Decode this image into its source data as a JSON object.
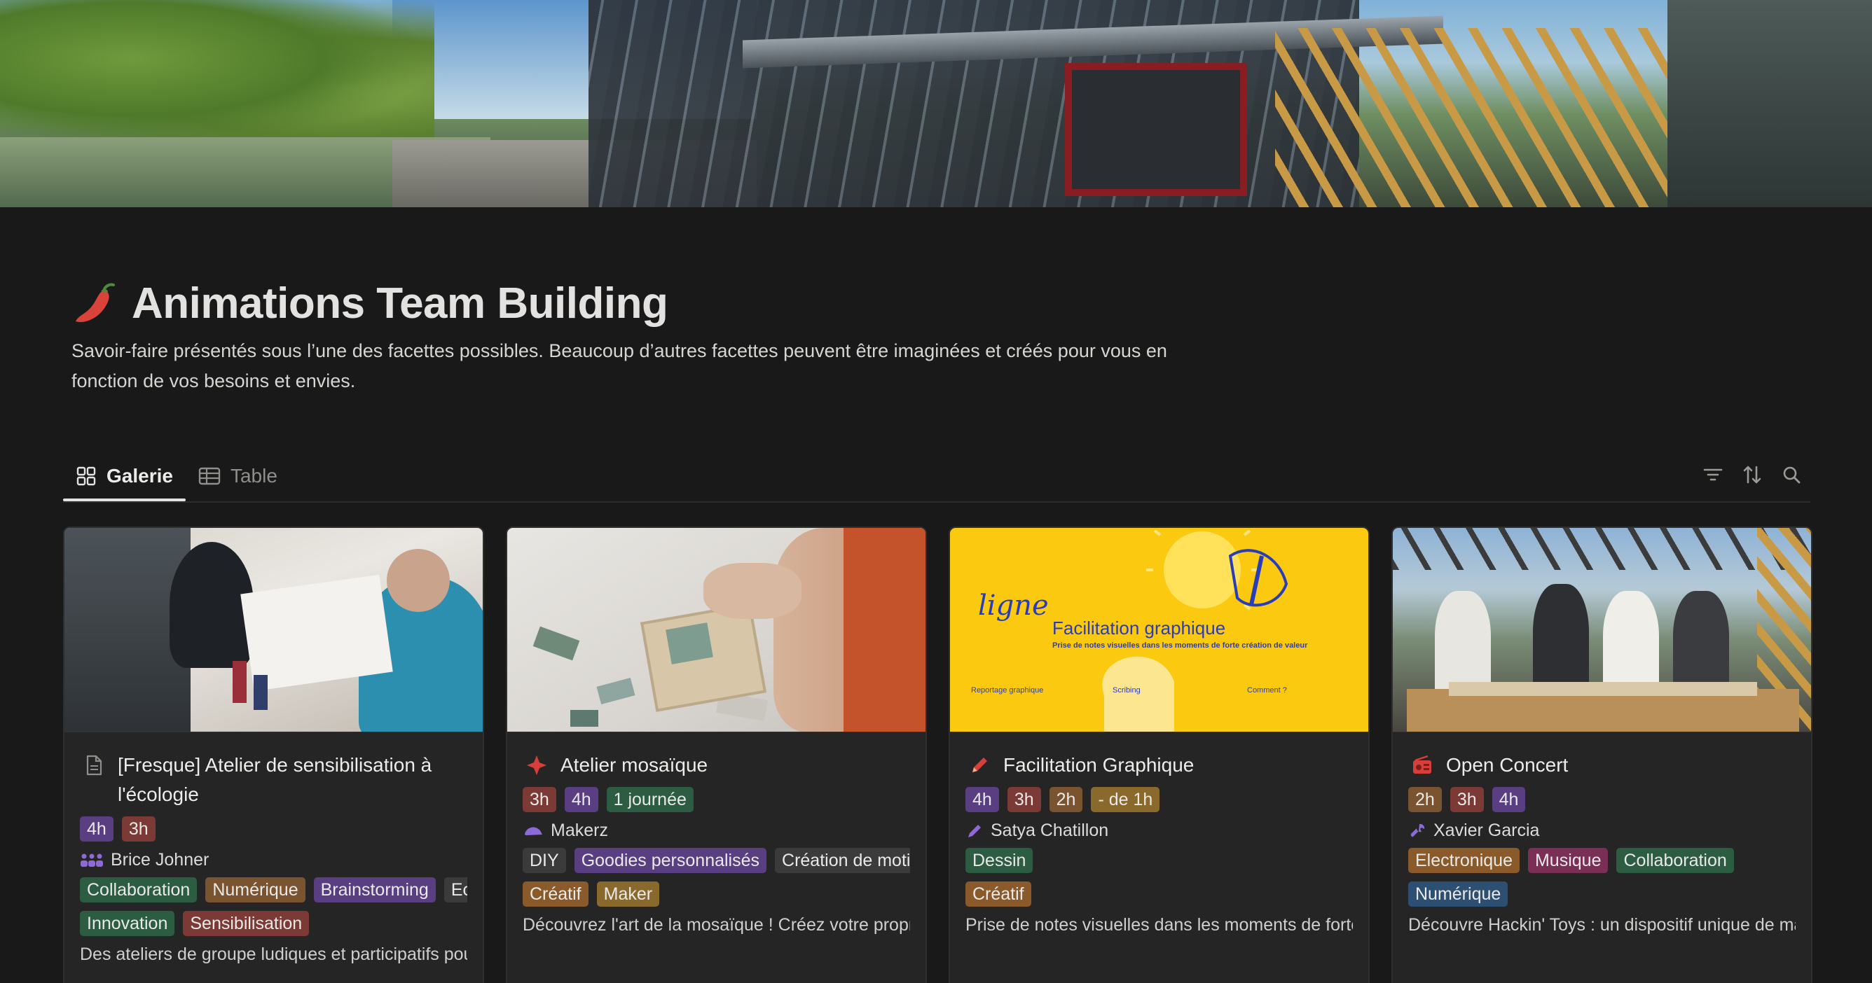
{
  "page": {
    "title": "Animations Team Building",
    "description": "Savoir-faire présentés sous l’une des facettes possibles. Beaucoup d’autres facettes peuvent être imaginées et créés pour vous en fonction de vos besoins et envies.",
    "icon": "chili-pepper-icon"
  },
  "tabs": [
    {
      "label": "Galerie",
      "icon": "gallery-icon",
      "active": true
    },
    {
      "label": "Table",
      "icon": "table-icon",
      "active": false
    }
  ],
  "tools": [
    "filter-icon",
    "sort-icon",
    "search-icon"
  ],
  "cards": [
    {
      "title": "[Fresque] Atelier de sensibilisation à l'écologie",
      "icon": "document-icon",
      "durations": [
        "4h",
        "3h"
      ],
      "person": "Brice Johner",
      "tags_row1": [
        "Collaboration",
        "Numérique",
        "Brainstorming",
        "Ec"
      ],
      "tags_row2": [
        "Innovation",
        "Sensibilisation"
      ],
      "description": "Des ateliers de groupe ludiques et participatifs pou"
    },
    {
      "title": "Atelier mosaïque",
      "icon": "red-star-icon",
      "durations": [
        "3h",
        "4h",
        "1 journée"
      ],
      "person": "Makerz",
      "tags_row1": [
        "DIY",
        "Goodies personnalisés",
        "Création de motif"
      ],
      "tags_row2": [
        "Créatif",
        "Maker"
      ],
      "description": "Découvrez l'art de la mosaïque ! Créez votre propre"
    },
    {
      "title": "Facilitation Graphique",
      "icon": "pencil-icon",
      "durations": [
        "4h",
        "3h",
        "2h",
        "- de 1h"
      ],
      "person": "Satya Chatillon",
      "tags_row1": [
        "Dessin"
      ],
      "tags_row2": [
        "Créatif"
      ],
      "description": "Prise de notes visuelles dans les moments de forte",
      "thumb_text": {
        "brand": "ligne",
        "heading": "Facilitation graphique",
        "sub": "Prise de notes visuelles dans les moments de forte création de valeur",
        "col1": "Reportage graphique",
        "col2": "Scribing",
        "col3": "Comment ?"
      }
    },
    {
      "title": "Open Concert",
      "icon": "radio-icon",
      "durations": [
        "2h",
        "3h",
        "4h"
      ],
      "person": "Xavier Garcia",
      "tags_row1": [
        "Electronique",
        "Musique",
        "Collaboration"
      ],
      "tags_row2": [
        "Numérique"
      ],
      "description": "Découvre Hackin' Toys : un dispositif unique de ma"
    }
  ]
}
